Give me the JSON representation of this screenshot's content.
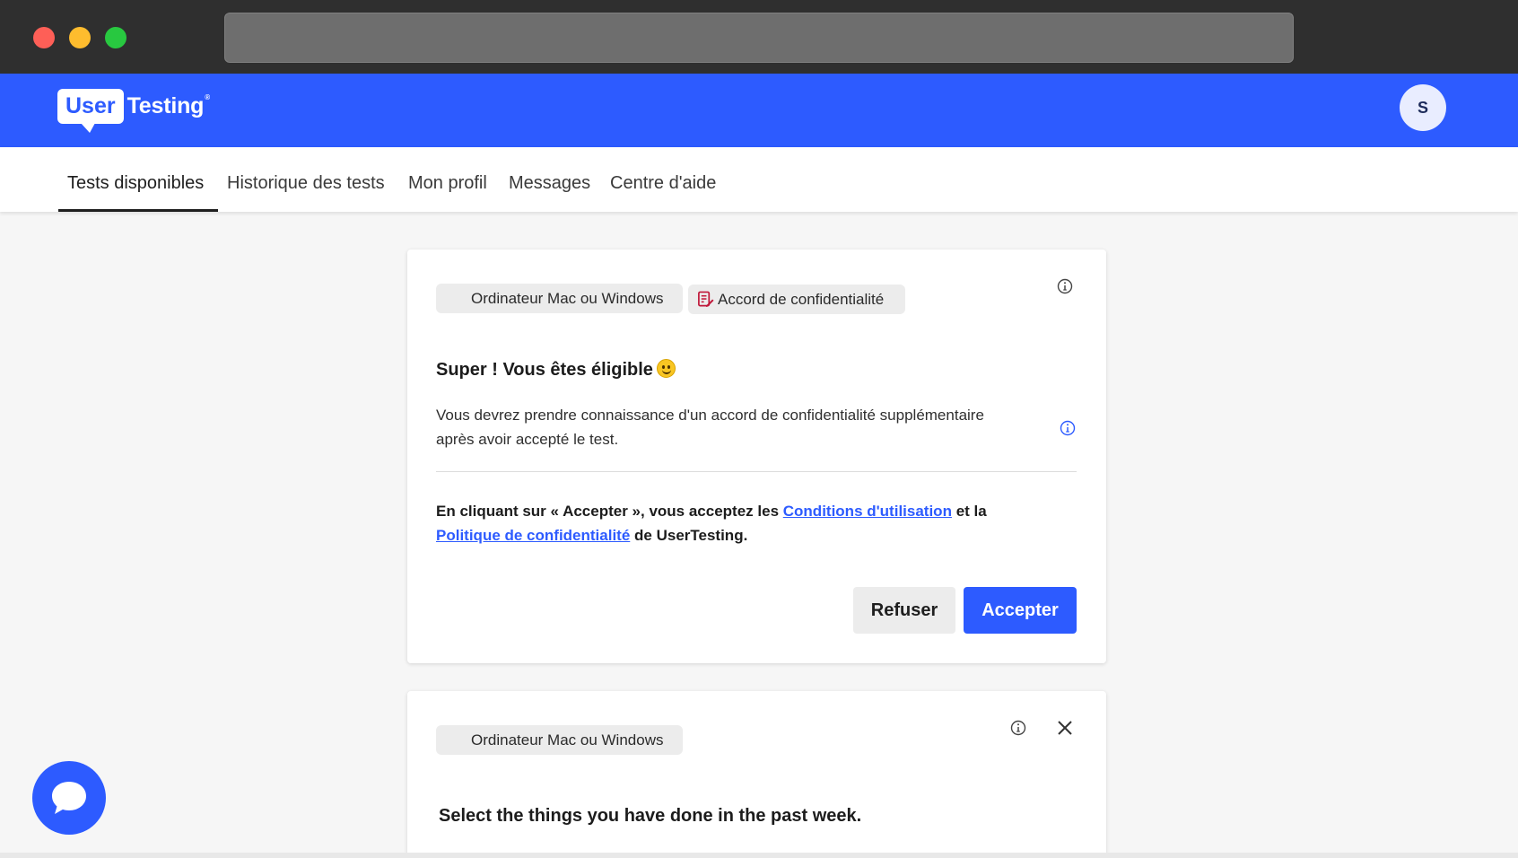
{
  "header": {
    "logo_user": "User",
    "logo_testing": "Testing",
    "logo_reg": "®",
    "avatar_initial": "S",
    "brand_color": "#2d5bff"
  },
  "nav": {
    "items": [
      {
        "label": "Tests disponibles",
        "active": true
      },
      {
        "label": "Historique des tests",
        "active": false
      },
      {
        "label": "Mon profil",
        "active": false
      },
      {
        "label": "Messages",
        "active": false
      },
      {
        "label": "Centre d'aide",
        "active": false
      }
    ]
  },
  "card1": {
    "chips": [
      {
        "label": "Ordinateur Mac ou Windows",
        "icon": "apple-windows-icon"
      },
      {
        "label": "Accord de confidentialité",
        "icon": "document-pen-icon"
      }
    ],
    "heading": "Super ! Vous êtes éligible",
    "heading_emoji": "grinning-face-icon",
    "body": "Vous devrez prendre connaissance d'un accord de confidentialité supplémentaire après avoir accepté le test.",
    "legal_prefix": "En cliquant sur « Accepter », vous acceptez les",
    "legal_link1": "Conditions d'utilisation",
    "legal_middle": "et la",
    "legal_link2": "Politique de confidentialité",
    "legal_suffix": "de UserTesting.",
    "refuse_label": "Refuser",
    "accept_label": "Accepter"
  },
  "card2": {
    "chip_label": "Ordinateur Mac ou Windows",
    "question": "Select the things you have done in the past week."
  },
  "chat": {
    "icon": "chat-bubble-icon"
  }
}
